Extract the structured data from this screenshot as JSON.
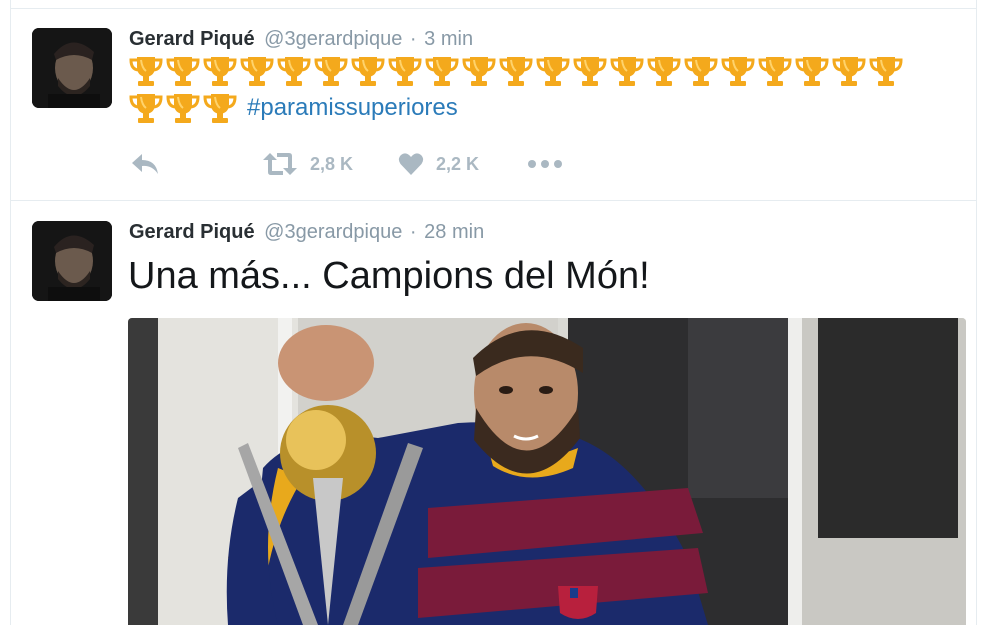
{
  "tweets": [
    {
      "author_name": "Gerard Piqué",
      "handle": "@3gerardpique",
      "separator": "·",
      "time": "3 min",
      "trophy_emoji_count": 24,
      "hashtag": "#paramissuperiores",
      "actions": {
        "reply_icon": "reply-icon",
        "retweet_icon": "retweet-icon",
        "retweet_count": "2,8 K",
        "like_icon": "heart-icon",
        "like_count": "2,2 K",
        "more_icon": "more-dots-icon"
      }
    },
    {
      "author_name": "Gerard Piqué",
      "handle": "@3gerardpique",
      "separator": "·",
      "time": "28 min",
      "text": "Una más... Campions del Món!",
      "media": "photo of player in blue and claret striped jersey holding a golden trophy in a locker room"
    }
  ],
  "colors": {
    "name": "#292f33",
    "meta": "#8899a6",
    "hashtag": "#2b7bb9",
    "action": "#aab8c2",
    "divider": "#e6ecf0",
    "trophy": "#f4a91c"
  }
}
